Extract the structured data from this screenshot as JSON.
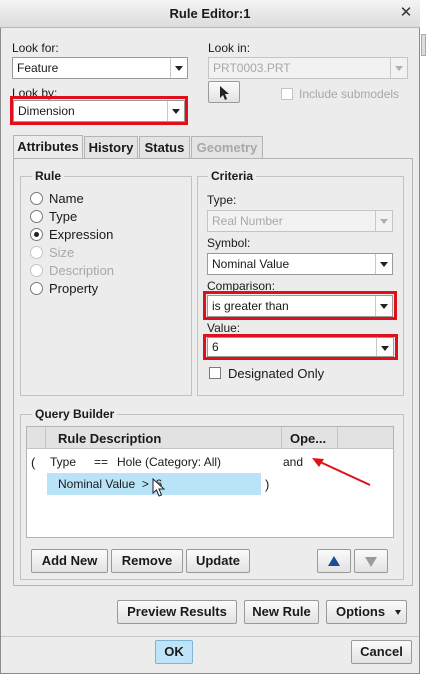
{
  "window": {
    "title": "Rule Editor:1"
  },
  "look_for": {
    "label": "Look for:",
    "value": "Feature"
  },
  "look_by": {
    "label": "Look by:",
    "value": "Dimension"
  },
  "look_in": {
    "label": "Look in:",
    "value": "PRT0003.PRT",
    "include_submodels": "Include submodels"
  },
  "tabs": [
    {
      "label": "Attributes",
      "active": true
    },
    {
      "label": "History"
    },
    {
      "label": "Status"
    },
    {
      "label": "Geometry",
      "disabled": true
    }
  ],
  "rule": {
    "title": "Rule",
    "options": [
      {
        "label": "Name"
      },
      {
        "label": "Type"
      },
      {
        "label": "Expression",
        "selected": true
      },
      {
        "label": "Size",
        "disabled": true
      },
      {
        "label": "Description",
        "disabled": true
      },
      {
        "label": "Property"
      }
    ]
  },
  "criteria": {
    "title": "Criteria",
    "type_label": "Type:",
    "type_value": "Real Number",
    "symbol_label": "Symbol:",
    "symbol_value": "Nominal Value",
    "comparison_label": "Comparison:",
    "comparison_value": "is greater than",
    "value_label": "Value:",
    "value_value": "6",
    "designated_only": "Designated Only"
  },
  "query_builder": {
    "title": "Query Builder",
    "col_rule_description": "Rule Description",
    "col_operator": "Ope...",
    "rows": [
      {
        "open": "(",
        "left": "Type",
        "op": "==",
        "right": "Hole (Category: All)",
        "operator": "and"
      },
      {
        "text": "Nominal Value  >  6",
        "close": ")"
      }
    ],
    "buttons": {
      "add_new": "Add New",
      "remove": "Remove",
      "update": "Update"
    }
  },
  "actions": {
    "preview": "Preview Results",
    "new_rule": "New Rule",
    "options": "Options"
  },
  "footer": {
    "ok": "OK",
    "cancel": "Cancel"
  },
  "colors": {
    "highlight": "#e0101a",
    "selection": "#b9e3f7",
    "ok_button": "#bfe4f7"
  }
}
